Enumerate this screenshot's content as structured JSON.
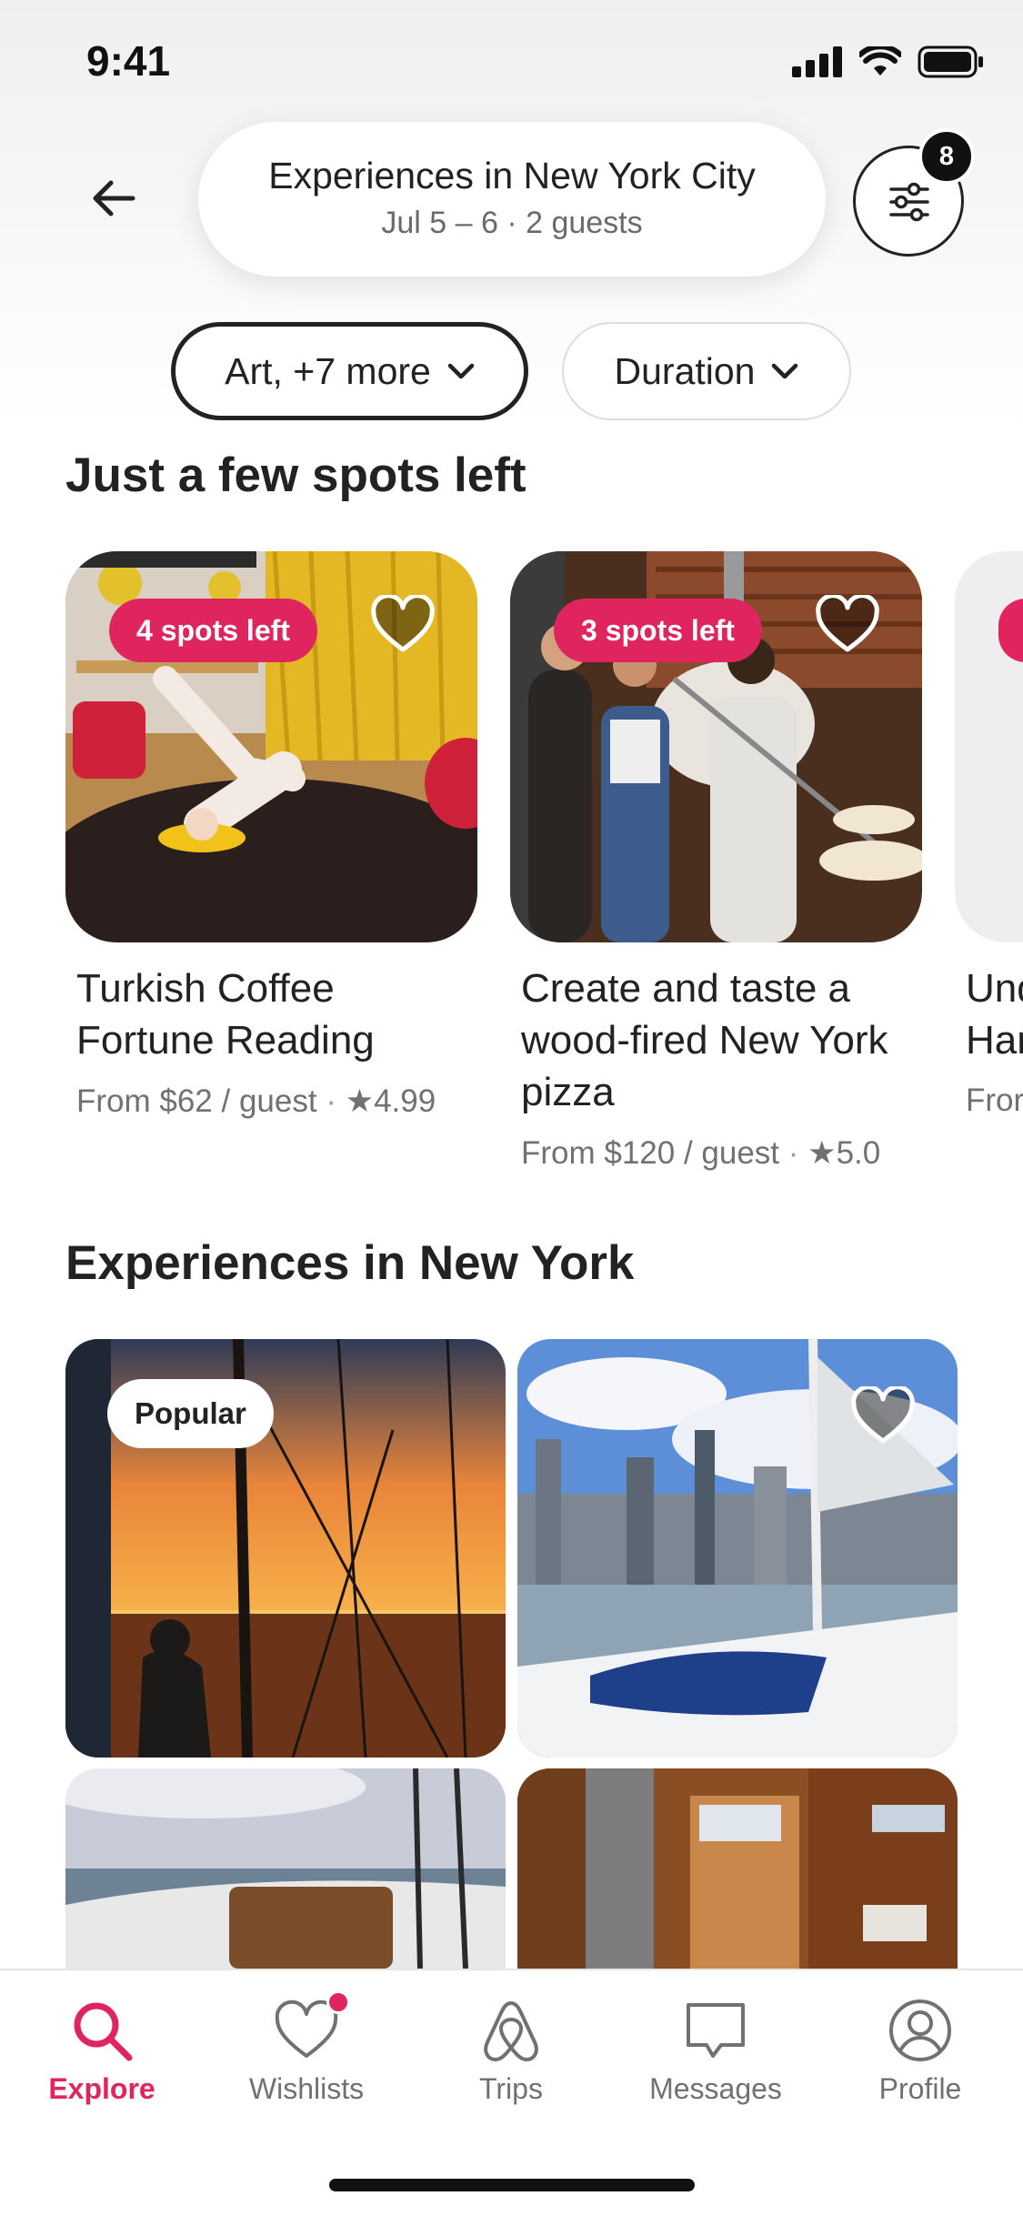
{
  "status_bar": {
    "time": "9:41"
  },
  "search": {
    "title": "Experiences in New York City",
    "subtitle": "Jul 5 – 6 · 2 guests"
  },
  "filters": {
    "badge_count": "8"
  },
  "chips": [
    {
      "label": "Art, +7 more",
      "selected": true
    },
    {
      "label": "Duration",
      "selected": false
    }
  ],
  "section1": {
    "title": "Just a few spots left",
    "cards": [
      {
        "badge": "4 spots left",
        "title": "Turkish Coffee Fortune Reading",
        "price": "From $62 / guest",
        "rating": "4.99"
      },
      {
        "badge": "3 spots left",
        "title": "Create and taste a wood-fired New York pizza",
        "price": "From $120 / guest",
        "rating": "5.0"
      },
      {
        "title": "Und\nHar",
        "price": "Fror"
      }
    ]
  },
  "section2": {
    "title": "Experiences in New York",
    "popular_badge": "Popular"
  },
  "tabbar": [
    {
      "label": "Explore",
      "icon": "search-icon",
      "active": true
    },
    {
      "label": "Wishlists",
      "icon": "heart-icon",
      "notification": true
    },
    {
      "label": "Trips",
      "icon": "airbnb-icon"
    },
    {
      "label": "Messages",
      "icon": "message-icon"
    },
    {
      "label": "Profile",
      "icon": "profile-icon"
    }
  ],
  "colors": {
    "accent": "#E0245E",
    "text": "#222222",
    "muted": "#717171"
  }
}
